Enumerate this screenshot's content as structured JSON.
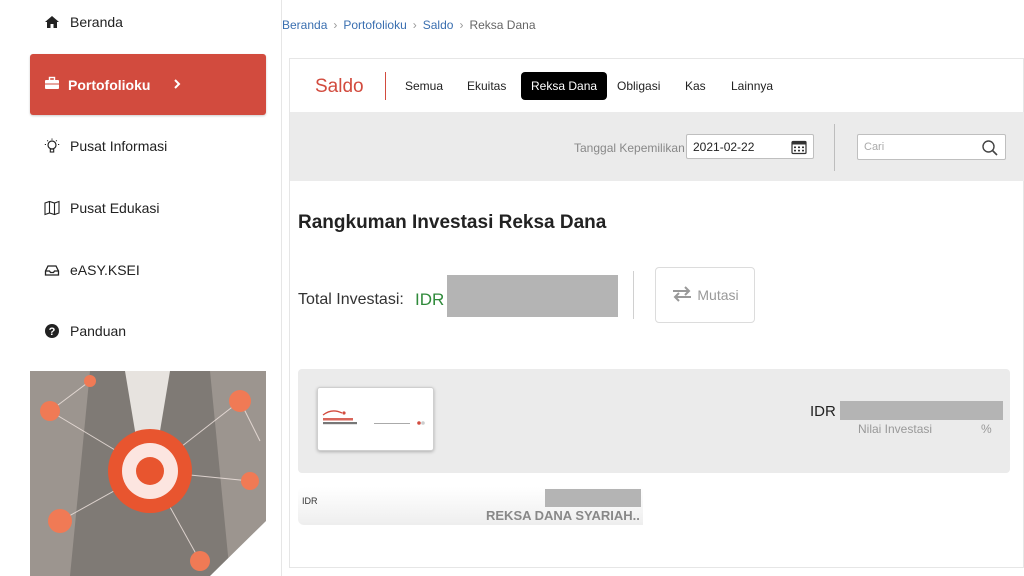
{
  "sidebar": {
    "items": [
      {
        "label": "Beranda",
        "icon": "home-icon"
      },
      {
        "label": "Portofolioku",
        "icon": "briefcase-icon",
        "active": true
      },
      {
        "label": "Pusat Informasi",
        "icon": "lightbulb-icon"
      },
      {
        "label": "Pusat Edukasi",
        "icon": "map-icon"
      },
      {
        "label": "eASY.KSEI",
        "icon": "inbox-icon"
      },
      {
        "label": "Panduan",
        "icon": "question-icon"
      }
    ]
  },
  "breadcrumb": [
    "Beranda",
    "Portofolioku",
    "Saldo",
    "Reksa Dana"
  ],
  "header": {
    "section": "Saldo",
    "tabs": [
      "Semua",
      "Ekuitas",
      "Reksa Dana",
      "Obligasi",
      "Kas",
      "Lainnya"
    ],
    "active_tab": "Reksa Dana"
  },
  "filter": {
    "date_label": "Tanggal Kepemilikan",
    "date_value": "2021-02-22",
    "search_placeholder": "Cari"
  },
  "summary": {
    "title": "Rangkuman Investasi Reksa Dana",
    "total_label": "Total Investasi:",
    "currency": "IDR",
    "mutasi_label": "Mutasi"
  },
  "fund_card": {
    "currency": "IDR",
    "nilai_label": "Nilai Investasi",
    "percent_label": "%"
  },
  "fund_row": {
    "currency": "IDR",
    "name": "REKSA DANA SYARIAH.."
  },
  "colors": {
    "accent": "#d24b3e",
    "positive": "#2f8a3a",
    "active_tab_bg": "#000000",
    "mask": "#b4b4b4"
  }
}
